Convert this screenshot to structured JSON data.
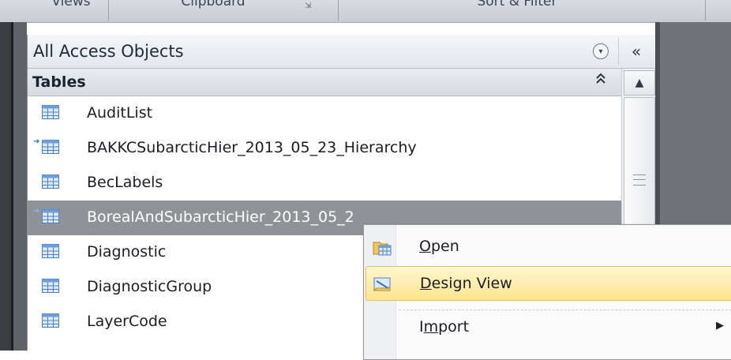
{
  "ribbon": {
    "groups": [
      {
        "label": "Views"
      },
      {
        "label": "Clipboard"
      },
      {
        "label": "Sort & Filter"
      }
    ]
  },
  "nav_pane": {
    "title": "All Access Objects",
    "menu_icon": "chevron-down-circle-icon",
    "collapse_symbol": "«",
    "group": {
      "label": "Tables",
      "toggle_symbol": "⌃⌃"
    },
    "items": [
      {
        "label": "AuditList",
        "linked": false,
        "selected": false
      },
      {
        "label": "BAKKCSubarcticHier_2013_05_23_Hierarchy",
        "linked": true,
        "selected": false
      },
      {
        "label": "BecLabels",
        "linked": false,
        "selected": false
      },
      {
        "label": "BorealAndSubarcticHier_2013_05_2",
        "linked": true,
        "selected": true
      },
      {
        "label": "Diagnostic",
        "linked": false,
        "selected": false
      },
      {
        "label": "DiagnosticGroup",
        "linked": false,
        "selected": false
      },
      {
        "label": "LayerCode",
        "linked": false,
        "selected": false
      }
    ]
  },
  "context_menu": {
    "items": [
      {
        "label": "Open",
        "accel": "O",
        "rest": "pen",
        "icon": "open-table-icon",
        "hover": false
      },
      {
        "label": "Design View",
        "accel": "D",
        "rest": "esign View",
        "icon": "design-view-icon",
        "hover": true
      },
      {
        "label": "Import",
        "accel_pre": "I",
        "accel": "m",
        "rest": "port",
        "icon": "",
        "submenu": true
      }
    ]
  },
  "colors": {
    "selection": "#8f9297",
    "menu_hover": "#fde58f",
    "link_arrow": "#2a74d4"
  }
}
